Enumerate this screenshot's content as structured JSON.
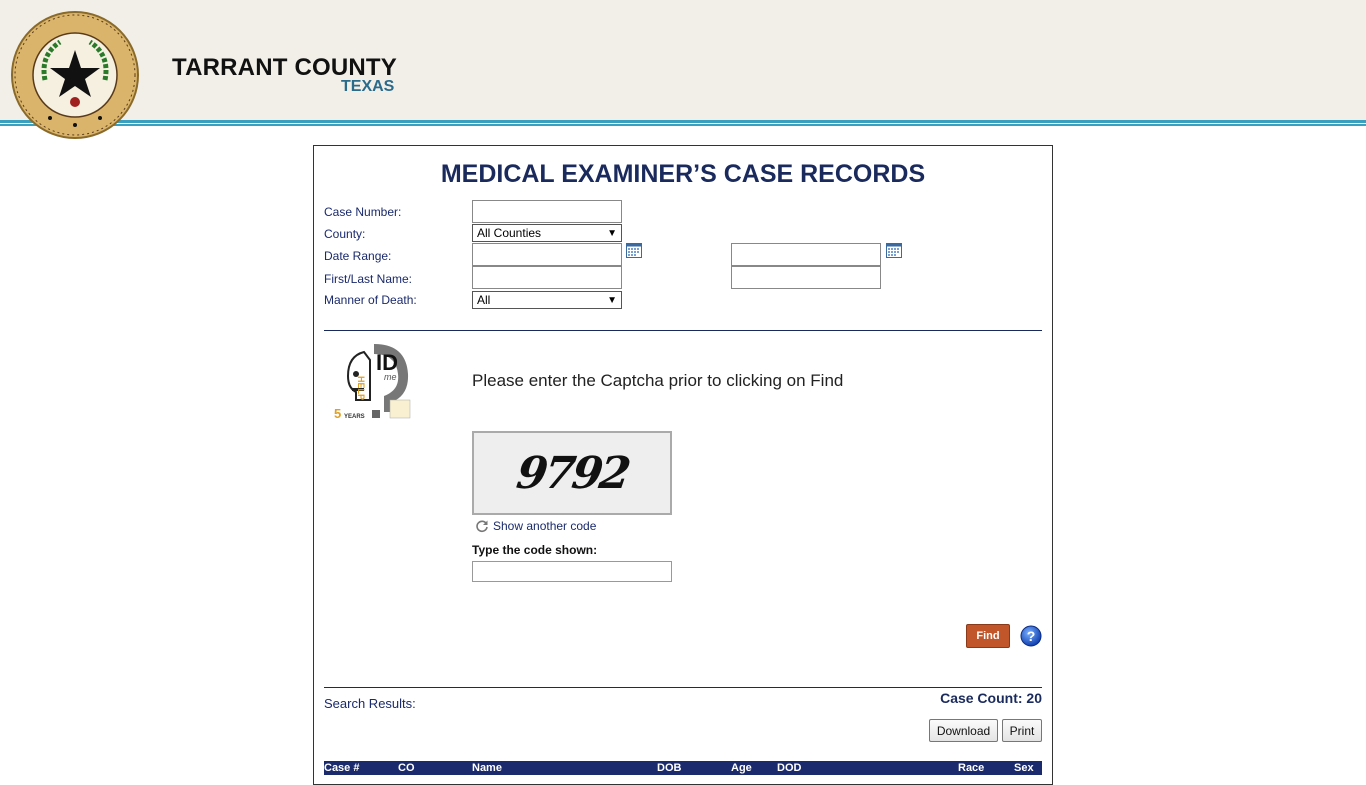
{
  "header": {
    "title": "TARRANT COUNTY",
    "subtitle": "TEXAS",
    "seal_icon": "county-seal-icon"
  },
  "form": {
    "title": "MEDICAL EXAMINER’S CASE RECORDS",
    "case_number_label": "Case Number:",
    "county_label": "County:",
    "county_selected": "All Counties",
    "date_range_label": "Date Range:",
    "name_label": "First/Last Name:",
    "manner_label": "Manner of Death:",
    "manner_selected": "All"
  },
  "captcha": {
    "message": "Please enter the Captcha prior to clicking on Find",
    "code": "9792",
    "refresh_label": "Show another code",
    "type_label": "Type the code shown:"
  },
  "logo": {
    "id_text": "ID",
    "help_text": "HELP",
    "me_text": "me",
    "years_num": "5",
    "years_text": "YEARS"
  },
  "actions": {
    "find_label": "Find",
    "download_label": "Download",
    "print_label": "Print"
  },
  "results": {
    "label": "Search Results:",
    "case_count": "Case Count: 20",
    "columns": [
      "Case #",
      "CO",
      "Name",
      "DOB",
      "Age",
      "DOD",
      "Race",
      "Sex"
    ]
  },
  "colors": {
    "header_bg": "#f2efe9",
    "accent_line": "#3aa0c0",
    "title_navy": "#1a2a5c",
    "find_button": "#c0562a",
    "table_header": "#1a2a6c"
  }
}
